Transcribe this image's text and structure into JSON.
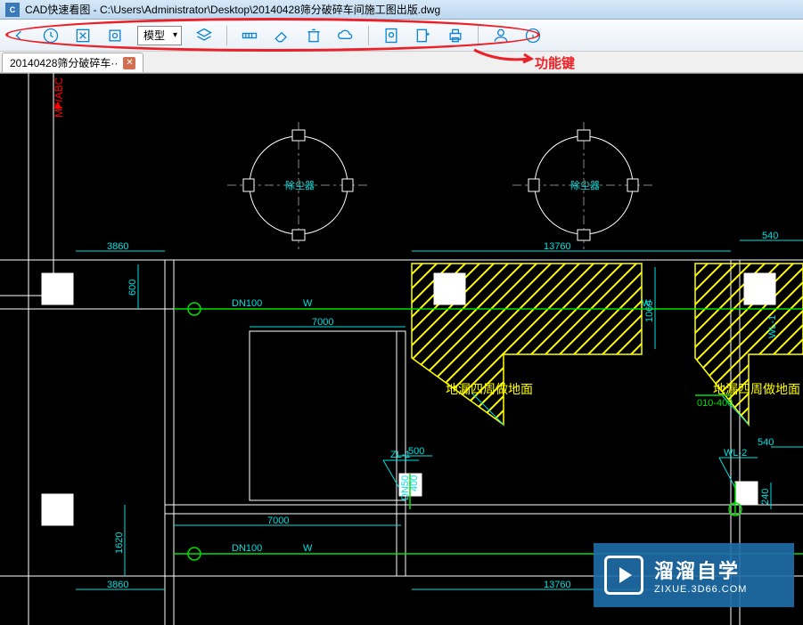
{
  "titlebar": {
    "app_name": "CAD快速看图",
    "file_path": "C:\\Users\\Administrator\\Desktop\\20140428筛分破碎车间施工图出版.dwg"
  },
  "toolbar": {
    "model_label": "模型"
  },
  "annotation": {
    "label": "功能键"
  },
  "tab": {
    "label": "20140428筛分破碎车··"
  },
  "drawing": {
    "red_label": "MF/ABC",
    "circle1_label": "除尘器",
    "circle2_label": "除尘器",
    "dim_3860": "3860",
    "dim_13760_top": "13760",
    "dim_540": "540",
    "dim_600": "600",
    "dim_7000_top": "7000",
    "dim_500": "500",
    "dim_1060": "1060",
    "dim_400": "400",
    "dim_240": "240",
    "dim_540b": "540",
    "dim_1620": "1620",
    "dim_7000_bot": "7000",
    "dim_3860_bot": "3860",
    "dim_13760_bot": "13760",
    "dn100_1": "DN100",
    "dn100_2": "DN100",
    "w_label_1": "W",
    "w_label_2": "W",
    "w_label_3": "W",
    "wl1": "WL-1",
    "wl2": "WL-2",
    "zl1": "ZL-1",
    "yellow_note_1": "地漏四周做地面",
    "yellow_note_2": "地漏四周做地面",
    "green_label": "010-400"
  },
  "watermark": {
    "title": "溜溜自学",
    "url": "ZIXUE.3D66.COM"
  }
}
